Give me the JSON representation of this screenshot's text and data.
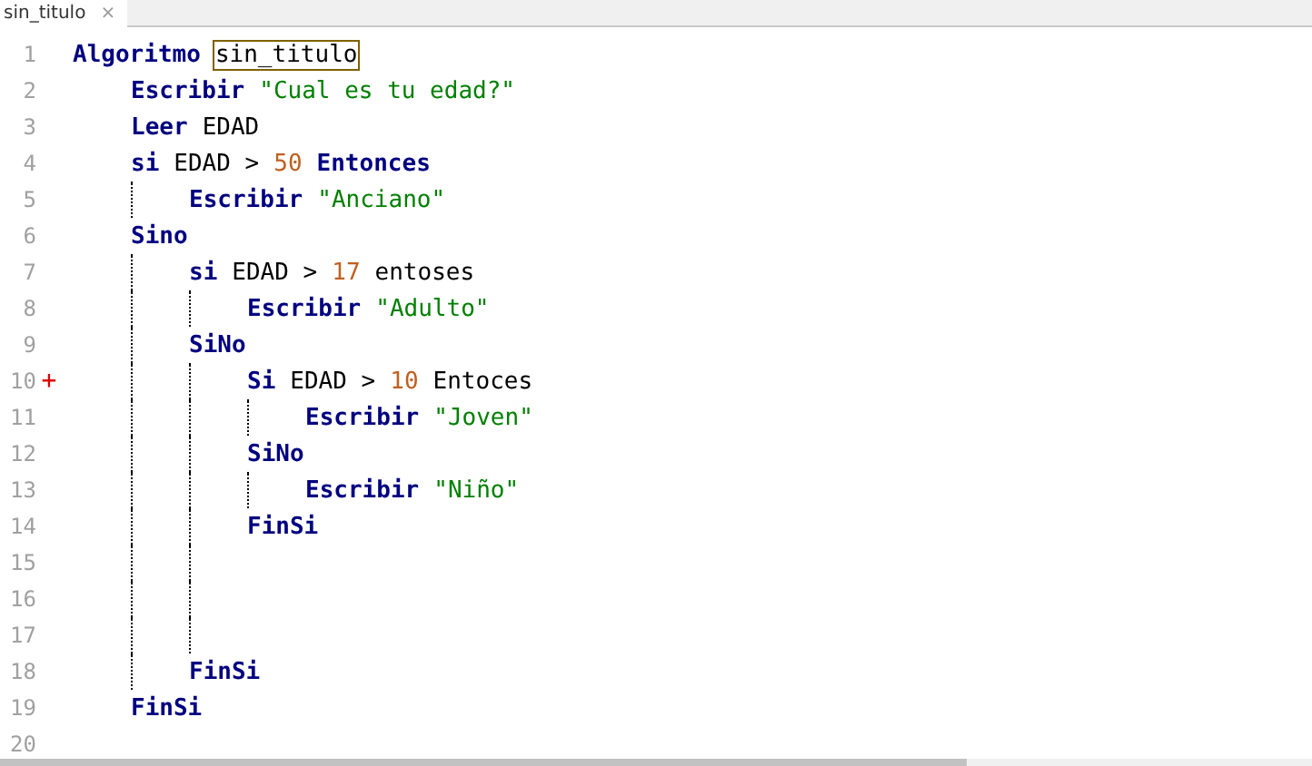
{
  "tab": {
    "label": "sin_titulo",
    "close": "×",
    "selected": true
  },
  "lines": [
    {
      "number": "1",
      "tokens": [
        {
          "kind": "keyword",
          "text": "Algoritmo"
        },
        {
          "kind": "highlight",
          "text": "sin_titulo"
        }
      ],
      "children": [
        {
          "number": "2",
          "tokens": [
            {
              "kind": "keyword",
              "text": "Escribir"
            },
            {
              "kind": "string",
              "text": "\"Cual es tu edad?\""
            }
          ]
        },
        {
          "number": "3",
          "tokens": [
            {
              "kind": "keyword",
              "text": "Leer"
            },
            {
              "kind": "plain",
              "text": "EDAD"
            }
          ]
        },
        {
          "number": "4",
          "tokens": [
            {
              "kind": "keyword",
              "text": "si"
            },
            {
              "kind": "plain",
              "text": "EDAD >"
            },
            {
              "kind": "number",
              "text": "50"
            },
            {
              "kind": "keyword",
              "text": "Entonces"
            }
          ],
          "children": [
            {
              "number": "5",
              "tokens": [
                {
                  "kind": "keyword",
                  "text": "Escribir"
                },
                {
                  "kind": "string",
                  "text": "\"Anciano\""
                }
              ]
            }
          ]
        },
        {
          "number": "6",
          "tokens": [
            {
              "kind": "keyword",
              "text": "Sino"
            }
          ],
          "children": [
            {
              "number": "7",
              "tokens": [
                {
                  "kind": "keyword",
                  "text": "si"
                },
                {
                  "kind": "plain",
                  "text": "EDAD >"
                },
                {
                  "kind": "number",
                  "text": "17"
                },
                {
                  "kind": "plain",
                  "text": "entoses"
                }
              ],
              "children": [
                {
                  "number": "8",
                  "tokens": [
                    {
                      "kind": "keyword",
                      "text": "Escribir"
                    },
                    {
                      "kind": "string",
                      "text": "\"Adulto\""
                    }
                  ]
                }
              ]
            },
            {
              "number": "9",
              "tokens": [
                {
                  "kind": "keyword",
                  "text": "SiNo"
                }
              ],
              "children": [
                {
                  "number": "10",
                  "marker": "+",
                  "tokens": [
                    {
                      "kind": "keyword",
                      "text": "Si"
                    },
                    {
                      "kind": "plain",
                      "text": "EDAD >"
                    },
                    {
                      "kind": "number",
                      "text": "10"
                    },
                    {
                      "kind": "plain",
                      "text": "Entoces"
                    }
                  ],
                  "children": [
                    {
                      "number": "11",
                      "tokens": [
                        {
                          "kind": "keyword",
                          "text": "Escribir"
                        },
                        {
                          "kind": "string",
                          "text": "\"Joven\""
                        }
                      ]
                    }
                  ]
                },
                {
                  "number": "12",
                  "tokens": [
                    {
                      "kind": "keyword",
                      "text": "SiNo"
                    }
                  ],
                  "children": [
                    {
                      "number": "13",
                      "tokens": [
                        {
                          "kind": "keyword",
                          "text": "Escribir"
                        },
                        {
                          "kind": "string",
                          "text": "\"Niño\""
                        }
                      ]
                    }
                  ]
                },
                {
                  "number": "14",
                  "tokens": [
                    {
                      "kind": "keyword",
                      "text": "FinSi"
                    }
                  ]
                },
                {
                  "number": "15"
                },
                {
                  "number": "16"
                },
                {
                  "number": "17"
                }
              ]
            },
            {
              "number": "18",
              "tokens": [
                {
                  "kind": "keyword",
                  "text": "FinSi"
                }
              ]
            }
          ]
        },
        {
          "number": "19",
          "tokens": [
            {
              "kind": "keyword",
              "text": "FinSi"
            }
          ]
        }
      ]
    },
    {
      "number": "20"
    }
  ]
}
